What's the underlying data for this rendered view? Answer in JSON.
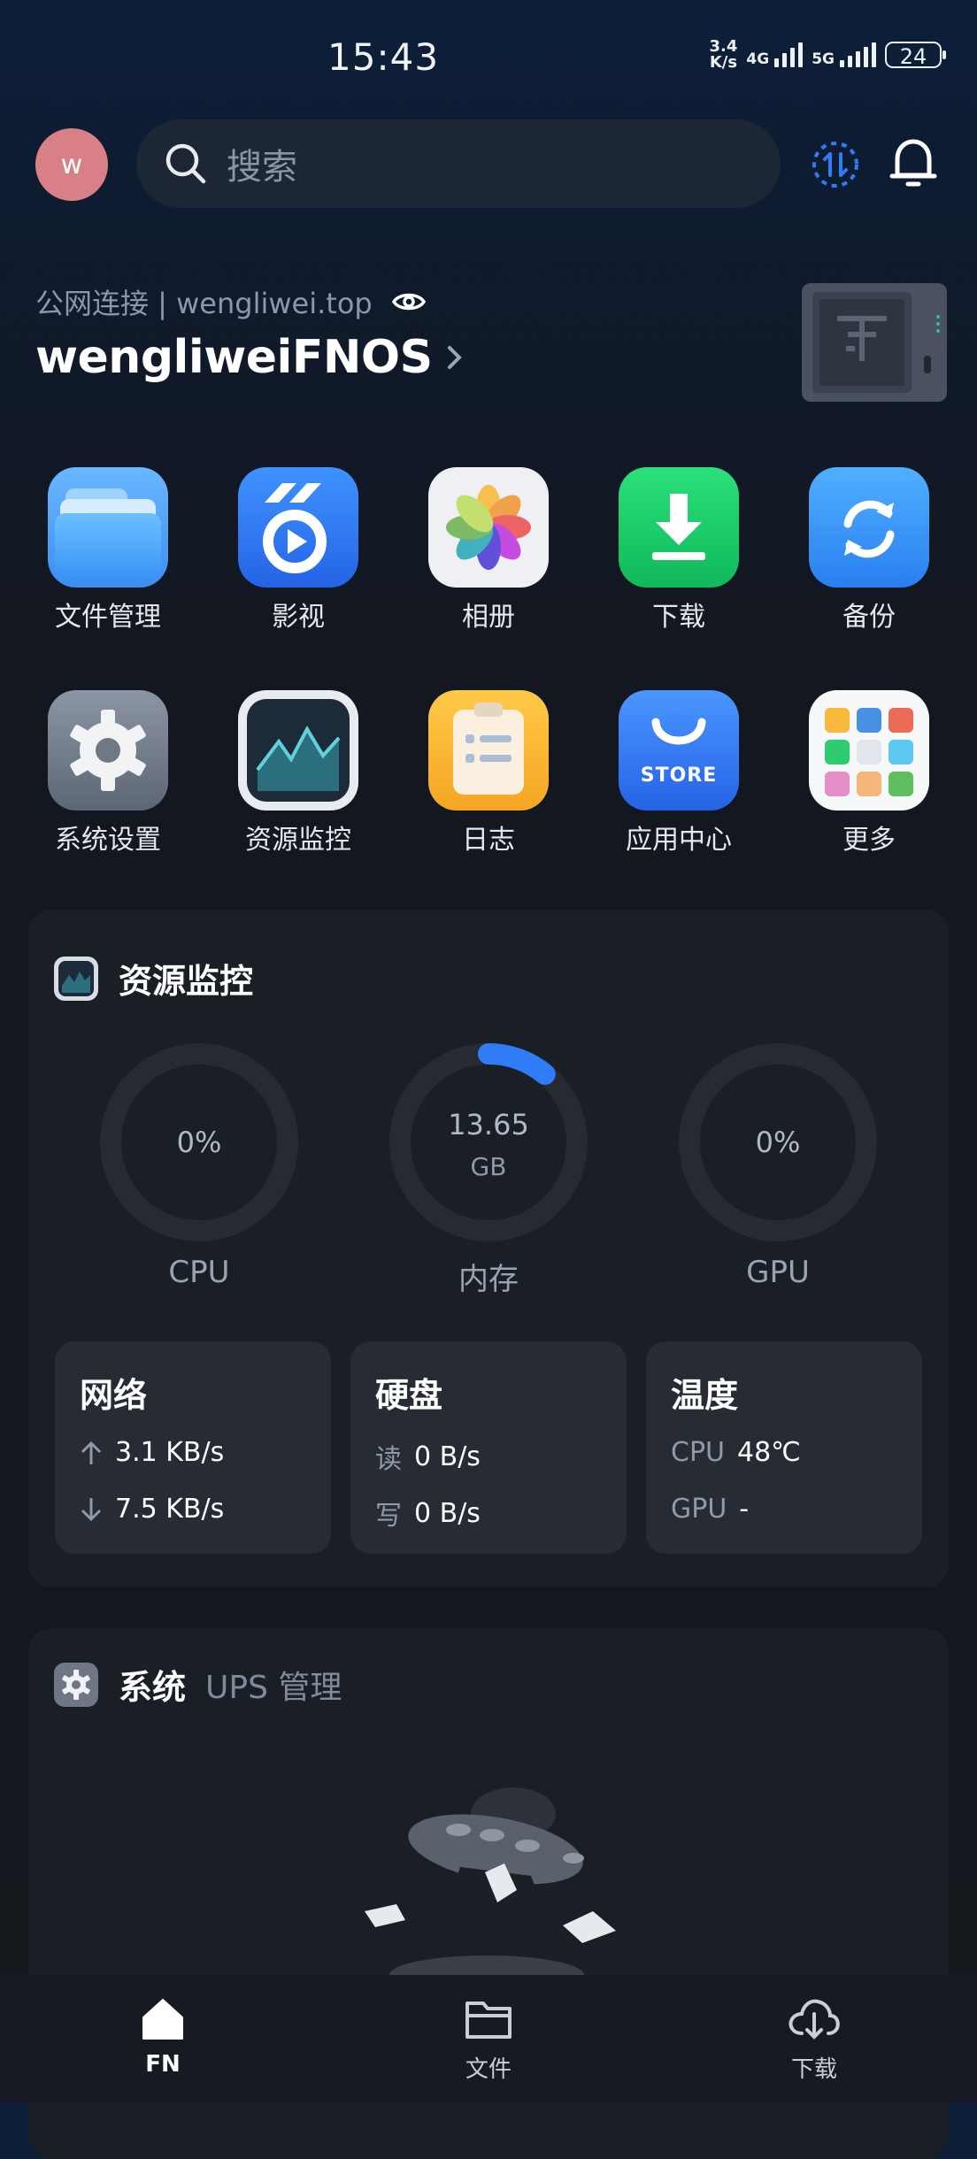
{
  "status_bar": {
    "time": "15:43",
    "speed_value": "3.4",
    "speed_unit": "K/s",
    "net1": "4G",
    "net2": "5G",
    "battery": "24"
  },
  "header": {
    "avatar_letter": "w",
    "search_placeholder": "搜索"
  },
  "device": {
    "connection": "公网连接 | wengliwei.top",
    "name": "wengliweiFNOS"
  },
  "apps": [
    {
      "label": "文件管理",
      "icon": "folder-icon"
    },
    {
      "label": "影视",
      "icon": "video-icon"
    },
    {
      "label": "相册",
      "icon": "photos-icon"
    },
    {
      "label": "下载",
      "icon": "download-icon"
    },
    {
      "label": "备份",
      "icon": "backup-icon"
    },
    {
      "label": "系统设置",
      "icon": "settings-icon"
    },
    {
      "label": "资源监控",
      "icon": "monitor-icon"
    },
    {
      "label": "日志",
      "icon": "log-icon"
    },
    {
      "label": "应用中心",
      "icon": "store-icon",
      "badge": "STORE"
    },
    {
      "label": "更多",
      "icon": "more-icon"
    }
  ],
  "resource_monitor": {
    "title": "资源监控",
    "cpu": {
      "value": "0%",
      "label": "CPU",
      "fraction": 0
    },
    "memory": {
      "value": "13.65",
      "unit": "GB",
      "label": "内存",
      "fraction": 0.11
    },
    "gpu": {
      "value": "0%",
      "label": "GPU",
      "fraction": 0
    },
    "network": {
      "title": "网络",
      "up": "3.1 KB/s",
      "down": "7.5 KB/s"
    },
    "disk": {
      "title": "硬盘",
      "read_label": "读",
      "read": "0 B/s",
      "write_label": "写",
      "write": "0 B/s"
    },
    "temperature": {
      "title": "温度",
      "cpu_label": "CPU",
      "cpu": "48℃",
      "gpu_label": "GPU",
      "gpu": "-"
    }
  },
  "system": {
    "title": "系统",
    "tab": "UPS 管理"
  },
  "tabbar": {
    "items": [
      {
        "label": "FN",
        "icon": "home-icon",
        "active": true
      },
      {
        "label": "文件",
        "icon": "folder-icon"
      },
      {
        "label": "下载",
        "icon": "download-cloud-icon"
      }
    ]
  },
  "colors": {
    "accent": "#2f7cf6",
    "avatar": "#d98087",
    "ring_track": "#252a33"
  }
}
